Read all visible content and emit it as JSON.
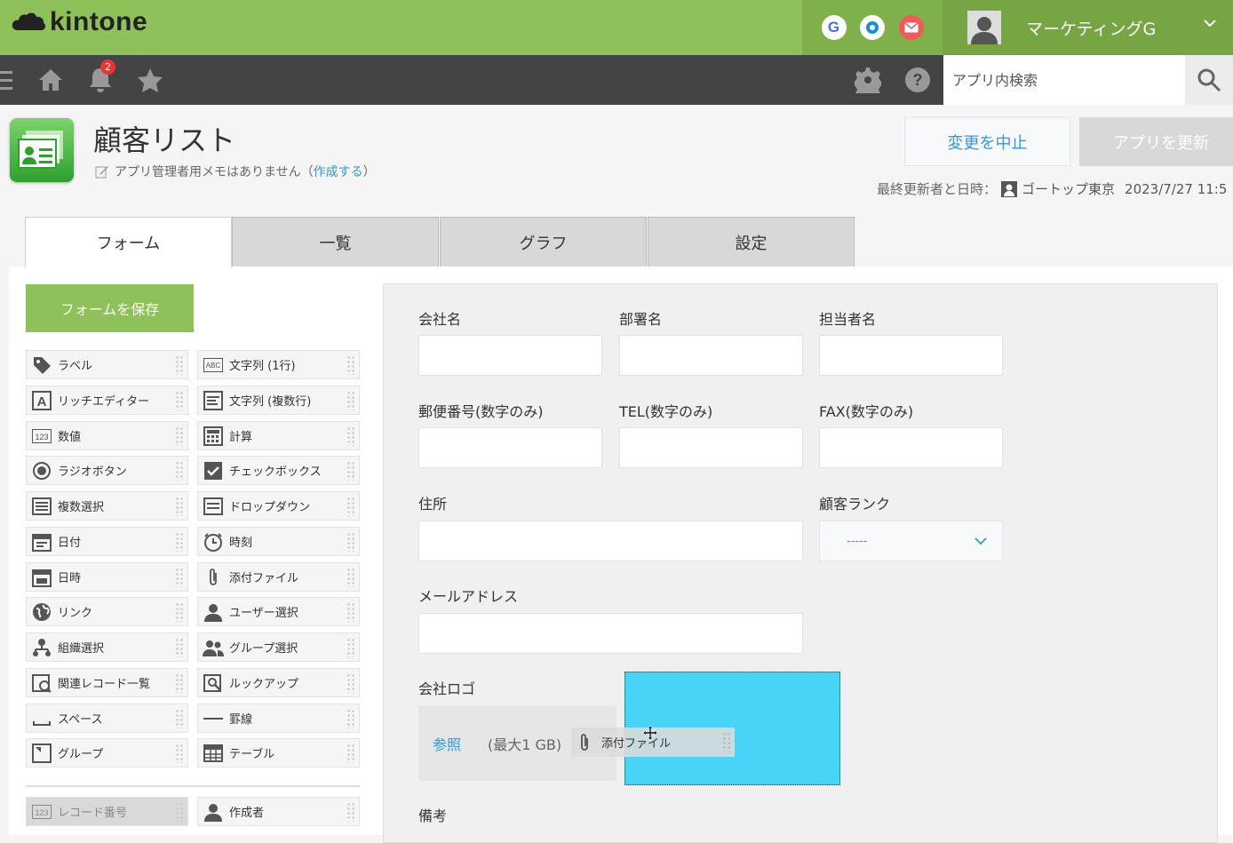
{
  "header": {
    "brand": "kintone",
    "user_name": "マーケティングG",
    "brand_color": "#8fc15a",
    "icons": [
      "google-g-icon",
      "garoon-icon",
      "mail-icon"
    ]
  },
  "nav": {
    "notification_count": "2",
    "search_placeholder": "アプリ内検索"
  },
  "app": {
    "title": "顧客リスト",
    "memo_text": "アプリ管理者用メモはありません（",
    "memo_link": "作成する",
    "memo_close": "）",
    "cancel_label": "変更を中止",
    "update_label": "アプリを更新",
    "last_updated_label": "最終更新者と日時：",
    "last_updated_user": "ゴートップ東京",
    "last_updated_time": "2023/7/27 11:5"
  },
  "tabs": [
    "フォーム",
    "一覧",
    "グラフ",
    "設定"
  ],
  "palette": {
    "save_label": "フォームを保存",
    "left": [
      "ラベル",
      "リッチエディター",
      "数値",
      "ラジオボタン",
      "複数選択",
      "日付",
      "日時",
      "リンク",
      "組織選択",
      "関連レコード一覧",
      "スペース",
      "グループ"
    ],
    "right": [
      "文字列 (1行)",
      "文字列 (複数行)",
      "計算",
      "チェックボックス",
      "ドロップダウン",
      "時刻",
      "添付ファイル",
      "ユーザー選択",
      "グループ選択",
      "ルックアップ",
      "罫線",
      "テーブル"
    ],
    "bottom_left": "レコード番号",
    "bottom_right": "作成者"
  },
  "form": {
    "company": "会社名",
    "department": "部署名",
    "person": "担当者名",
    "zip": "郵便番号(数字のみ)",
    "tel": "TEL(数字のみ)",
    "fax": "FAX(数字のみ)",
    "address": "住所",
    "rank": "顧客ランク",
    "rank_value": "-----",
    "email": "メールアドレス",
    "logo": "会社ロゴ",
    "attach_ref": "参照",
    "attach_max": "(最大1 GB)",
    "notes": "備考"
  },
  "drag": {
    "label": "添付ファイル",
    "dropzone_color": "#49d4f7"
  }
}
